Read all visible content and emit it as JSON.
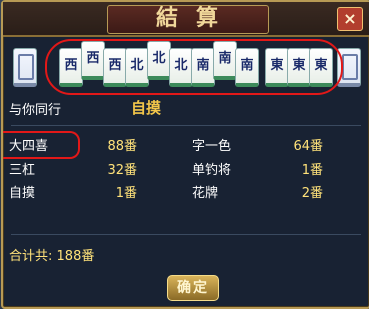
{
  "dialog": {
    "title": "結算",
    "close_label": "×"
  },
  "hand_tiles": [
    {
      "label": "",
      "kind": "blank"
    },
    {
      "label": "西",
      "kind": "wind"
    },
    {
      "label": "西",
      "kind": "wind",
      "raised": true
    },
    {
      "label": "西",
      "kind": "wind"
    },
    {
      "label": "北",
      "kind": "wind"
    },
    {
      "label": "北",
      "kind": "wind",
      "raised": true
    },
    {
      "label": "北",
      "kind": "wind"
    },
    {
      "label": "南",
      "kind": "wind"
    },
    {
      "label": "南",
      "kind": "wind",
      "raised": true
    },
    {
      "label": "南",
      "kind": "wind"
    },
    {
      "label": "東",
      "kind": "wind"
    },
    {
      "label": "東",
      "kind": "wind"
    },
    {
      "label": "東",
      "kind": "wind"
    },
    {
      "label": "",
      "kind": "blank"
    }
  ],
  "winner": {
    "player_label": "与你同行",
    "win_type": "自摸"
  },
  "fans": [
    {
      "name": "大四喜",
      "value": "88番"
    },
    {
      "name": "字一色",
      "value": "64番"
    },
    {
      "name": "三杠",
      "value": "32番"
    },
    {
      "name": "单钓将",
      "value": "1番"
    },
    {
      "name": "自摸",
      "value": "1番"
    },
    {
      "name": "花牌",
      "value": "2番"
    }
  ],
  "total": {
    "label": "合计共:",
    "value": "188番"
  },
  "confirm_label": "确定",
  "colors": {
    "accent_gold": "#f3c64a",
    "highlight_red": "#e21818",
    "panel_bg": "#182233"
  }
}
